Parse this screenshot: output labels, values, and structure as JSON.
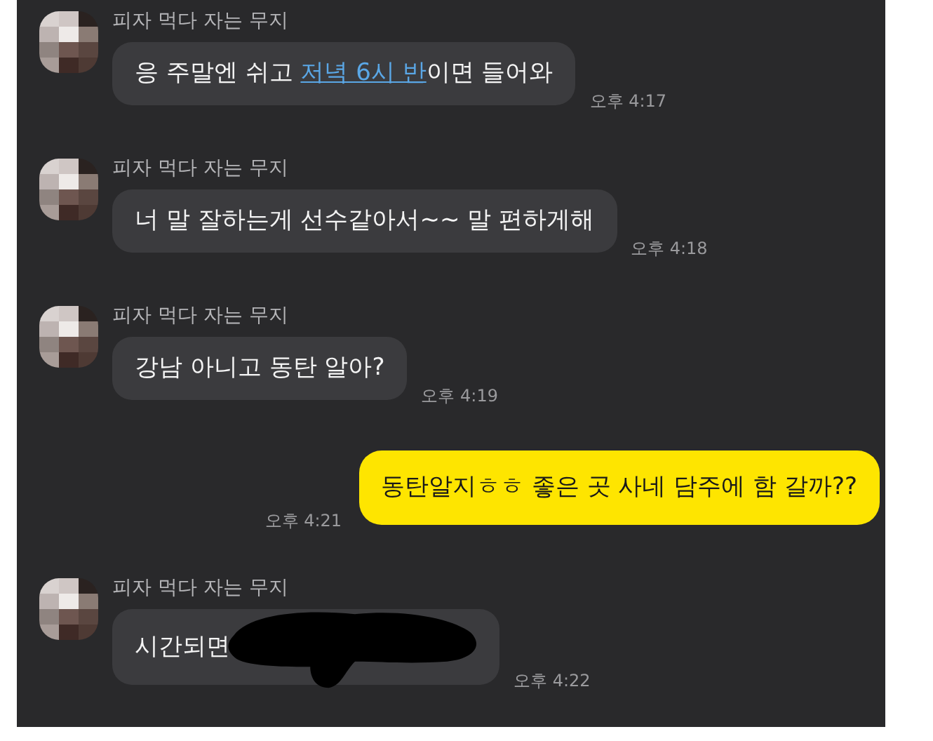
{
  "messages": [
    {
      "kind": "incoming",
      "sender": "피자 먹다 자는 무지",
      "parts": [
        {
          "text": "응 주말엔 쉬고 "
        },
        {
          "text": "저녁 6시 반",
          "link": true
        },
        {
          "text": "이면 들어와"
        }
      ],
      "time": "오후 4:17"
    },
    {
      "kind": "incoming",
      "sender": "피자 먹다 자는 무지",
      "parts": [
        {
          "text": "너 말 잘하는게 선수같아서~~ 말 편하게해"
        }
      ],
      "time": "오후 4:18"
    },
    {
      "kind": "incoming",
      "sender": "피자 먹다 자는 무지",
      "parts": [
        {
          "text": "강남 아니고 동탄 알아?"
        }
      ],
      "time": "오후 4:19"
    },
    {
      "kind": "outgoing",
      "parts": [
        {
          "text": "동탄알지ㅎㅎ 좋은 곳 사네 담주에 함 갈까??"
        }
      ],
      "time": "오후 4:21"
    },
    {
      "kind": "incoming",
      "sender": "피자 먹다 자는 무지",
      "parts": [
        {
          "text": "시간되면"
        }
      ],
      "redacted": true,
      "time": "오후 4:22"
    }
  ]
}
